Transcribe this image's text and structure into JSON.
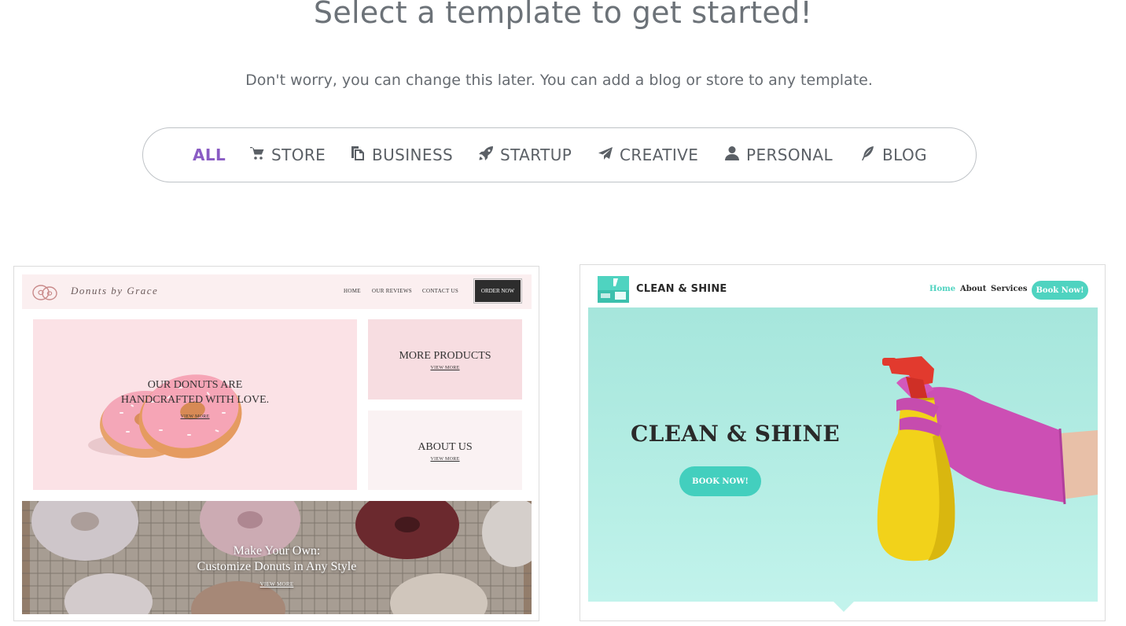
{
  "header": {
    "title": "Select a template to get started!",
    "subtitle": "Don't worry, you can change this later. You can add a blog or store to any template."
  },
  "filters": [
    {
      "label": "ALL",
      "icon": "none",
      "active": true
    },
    {
      "label": "STORE",
      "icon": "cart-icon",
      "active": false
    },
    {
      "label": "BUSINESS",
      "icon": "copy-icon",
      "active": false
    },
    {
      "label": "STARTUP",
      "icon": "rocket-icon",
      "active": false
    },
    {
      "label": "CREATIVE",
      "icon": "paper-plane-icon",
      "active": false
    },
    {
      "label": "PERSONAL",
      "icon": "user-icon",
      "active": false
    },
    {
      "label": "BLOG",
      "icon": "feather-icon",
      "active": false
    }
  ],
  "colors": {
    "accent": "#8a5cc4",
    "mint": "#4fd3c0",
    "pink": "#fbe2e6"
  },
  "templates": {
    "donuts": {
      "brand": "Donuts by Grace",
      "nav": [
        "HOME",
        "OUR REVIEWS",
        "CONTACT US"
      ],
      "order_button": "ORDER NOW",
      "hero_line1": "OUR DONUTS ARE",
      "hero_line2": "HANDCRAFTED WITH LOVE.",
      "hero_link": "VIEW MORE",
      "products_title": "MORE PRODUCTS",
      "products_link": "VIEW MORE",
      "about_title": "ABOUT US",
      "about_link": "VIEW MORE",
      "photo_line1": "Make Your Own:",
      "photo_line2": "Customize Donuts in Any Style",
      "photo_link": "VIEW MORE"
    },
    "clean": {
      "brand": "CLEAN & SHINE",
      "nav": [
        "Home",
        "About",
        "Services"
      ],
      "book_button": "Book Now!",
      "hero_title": "CLEAN & SHINE",
      "hero_button": "BOOK NOW!"
    }
  }
}
